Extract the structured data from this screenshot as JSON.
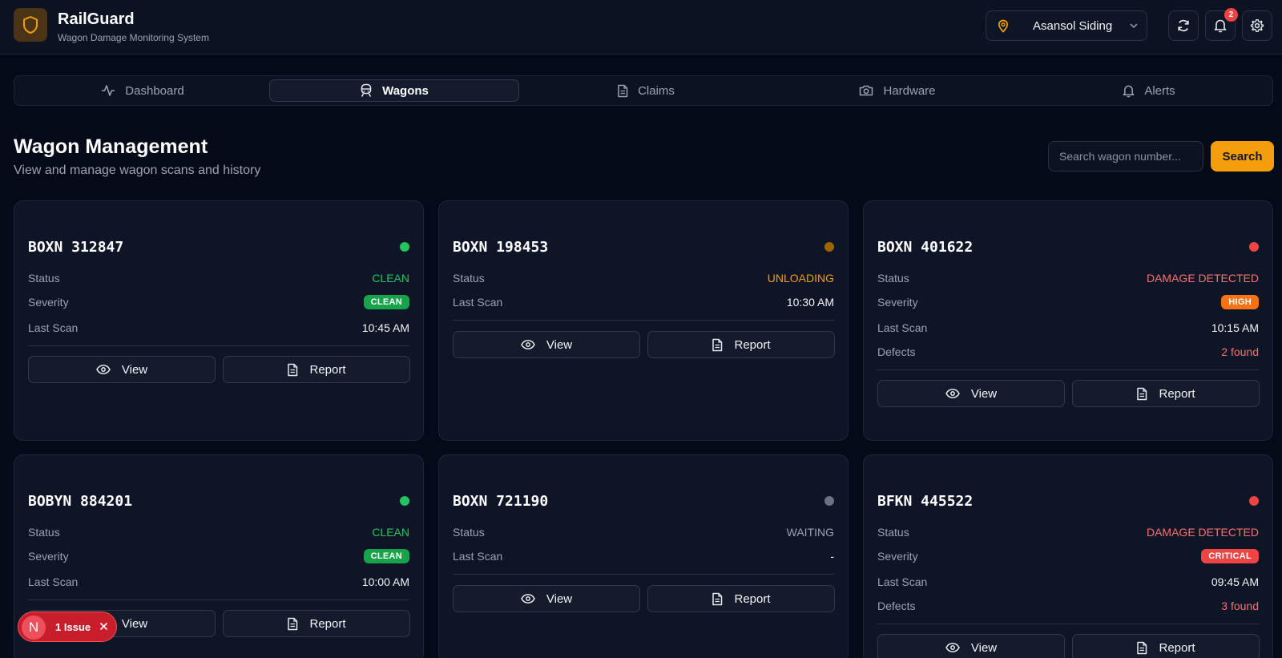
{
  "app": {
    "title": "RailGuard",
    "subtitle": "Wagon Damage Monitoring System",
    "brand_color": "#f59e0b"
  },
  "header": {
    "location": "Asansol Siding",
    "notification_count": "2",
    "icons": [
      "map-pin-icon",
      "chevron-down-icon",
      "refresh-icon",
      "bell-icon",
      "gear-icon"
    ]
  },
  "nav": {
    "tabs": [
      {
        "label": "Dashboard",
        "icon": "activity-icon"
      },
      {
        "label": "Wagons",
        "icon": "train-icon",
        "active": true
      },
      {
        "label": "Claims",
        "icon": "document-icon"
      },
      {
        "label": "Hardware",
        "icon": "camera-icon"
      },
      {
        "label": "Alerts",
        "icon": "bell-icon"
      }
    ]
  },
  "page": {
    "title": "Wagon Management",
    "subtitle": "View and manage wagon scans and history",
    "search_placeholder": "Search wagon number...",
    "search_label": "Search"
  },
  "labels": {
    "status": "Status",
    "severity": "Severity",
    "last_scan": "Last Scan",
    "defects": "Defects",
    "view": "View",
    "report": "Report"
  },
  "wagons": [
    {
      "id": "BOXN 312847",
      "status": "CLEAN",
      "status_color": "#22c55e",
      "dot_color": "#22c55e",
      "severity": "CLEAN",
      "severity_color": "#16a34a",
      "last_scan": "10:45 AM"
    },
    {
      "id": "BOXN 198453",
      "status": "UNLOADING",
      "status_color": "#f59e0b",
      "dot_color": "#a16207",
      "last_scan": "10:30 AM"
    },
    {
      "id": "BOXN 401622",
      "status": "DAMAGE DETECTED",
      "status_color": "#f87171",
      "dot_color": "#ef4444",
      "severity": "HIGH",
      "severity_color": "#f97316",
      "last_scan": "10:15 AM",
      "defects": "2 found",
      "defects_color": "#f87171"
    },
    {
      "id": "BOBYN 884201",
      "status": "CLEAN",
      "status_color": "#22c55e",
      "dot_color": "#22c55e",
      "severity": "CLEAN",
      "severity_color": "#16a34a",
      "last_scan": "10:00 AM"
    },
    {
      "id": "BOXN 721190",
      "status": "WAITING",
      "status_color": "#9ca3af",
      "dot_color": "#6b7280",
      "last_scan": "-"
    },
    {
      "id": "BFKN 445522",
      "status": "DAMAGE DETECTED",
      "status_color": "#f87171",
      "dot_color": "#ef4444",
      "severity": "CRITICAL",
      "severity_color": "#ef4444",
      "last_scan": "09:45 AM",
      "defects": "3 found",
      "defects_color": "#f87171"
    }
  ],
  "issue_toast": {
    "initial": "N",
    "label": "1 Issue"
  }
}
